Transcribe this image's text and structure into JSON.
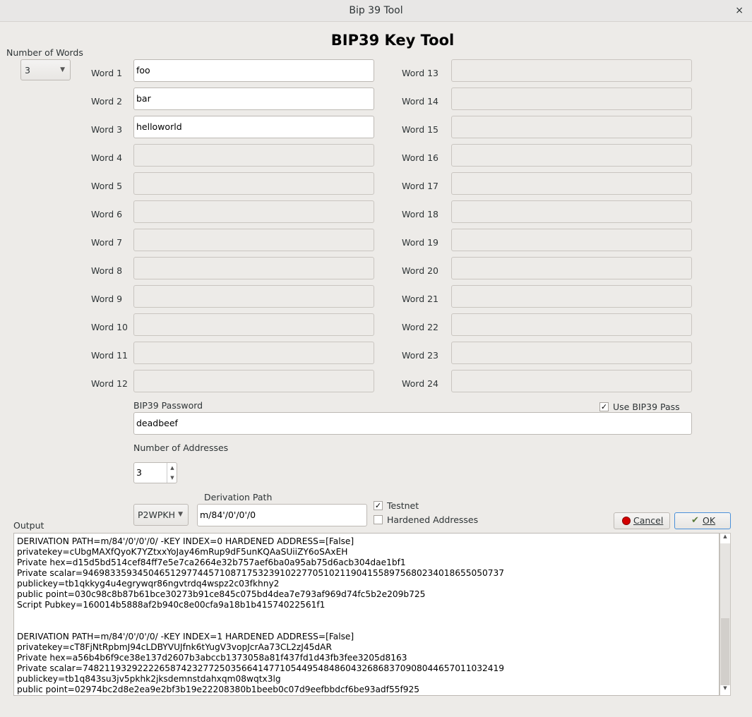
{
  "window": {
    "title": "Bip 39 Tool",
    "close": "×"
  },
  "main_title": "BIP39 Key Tool",
  "num_words": {
    "label": "Number of Words",
    "value": "3"
  },
  "words": {
    "labels": [
      "Word 1",
      "Word 2",
      "Word 3",
      "Word 4",
      "Word 5",
      "Word 6",
      "Word 7",
      "Word 8",
      "Word 9",
      "Word 10",
      "Word 11",
      "Word 12",
      "Word 13",
      "Word 14",
      "Word 15",
      "Word 16",
      "Word 17",
      "Word 18",
      "Word 19",
      "Word 20",
      "Word 21",
      "Word 22",
      "Word 23",
      "Word 24"
    ],
    "values": [
      "foo",
      "bar",
      "helloworld",
      "",
      "",
      "",
      "",
      "",
      "",
      "",
      "",
      "",
      "",
      "",
      "",
      "",
      "",
      "",
      "",
      "",
      "",
      "",
      "",
      ""
    ]
  },
  "password": {
    "label": "BIP39 Password",
    "value": "deadbeef",
    "use_label": "Use BIP39 Pass",
    "use_checked": true
  },
  "addresses": {
    "label": "Number of Addresses",
    "value": "3"
  },
  "script_type": "P2WPKH",
  "derivation": {
    "label": "Derivation Path",
    "value": "m/84'/0'/0'/0"
  },
  "testnet": {
    "label": "Testnet",
    "checked": true
  },
  "hardened": {
    "label": "Hardened Addresses",
    "checked": false
  },
  "buttons": {
    "cancel": "Cancel",
    "ok": "OK"
  },
  "output": {
    "label": "Output",
    "lines": [
      "DERIVATION PATH=m/84'/0'/0'/0/ -KEY INDEX=0 HARDENED ADDRESS=[False]",
      "privatekey=cUbgMAXfQyoK7YZtxxYoJay46mRup9dF5unKQAaSUiiZY6oSAxEH",
      "Private hex=d15d5bd514cef84ff7e5e7ca2664e32b757aef6ba0a95ab75d6acb304dae1bf1",
      "Private scalar=94698335934504651297744571087175323910227705102119041558975680234018655050737",
      "publickey=tb1qkkyg4u4egrywqr86ngvtrdq4wspz2c03fkhny2",
      "public point=030c98c8b87b61bce30273b91ce845c075bd4dea7e793af969d74fc5b2e209b725",
      "Script Pubkey=160014b5888af2b940c8e00cfa9a18b1b41574022561f1",
      "",
      "",
      "DERIVATION PATH=m/84'/0'/0'/0/ -KEY INDEX=1 HARDENED ADDRESS=[False]",
      "privatekey=cT8FjNtRpbmJ94cLDBYVUJfnk6tYugV3vopJcrAa73CL2zJ45dAR",
      "Private hex=a56b4b6f9ce38e137d2607b3abccb1373058a81f437fd1d43fb3fee3205d8163",
      "Private scalar=74821193292222658742327725035664147710544954848604326868370908044657011032419",
      "publickey=tb1q843su3jv5pkhk2jksdemnstdahxqm08wqtx3lg",
      "public point=02974bc2d8e2ea9e2bf3b19e22208380b1beeb0c07d9eefbbdcf6be93adf55f925"
    ]
  }
}
